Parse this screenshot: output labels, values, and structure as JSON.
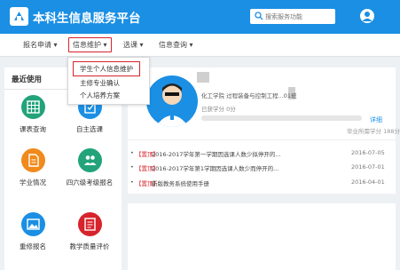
{
  "header": {
    "app_title": "本科生信息服务平台",
    "search_placeholder": "搜索服务功能"
  },
  "nav": {
    "items": [
      {
        "label": "报名申请 ▾"
      },
      {
        "label": "信息维护 ▾"
      },
      {
        "label": "选课 ▾"
      },
      {
        "label": "信息查询 ▾"
      }
    ]
  },
  "dropdown": {
    "items": [
      {
        "label": "学生个人信息维护"
      },
      {
        "label": "主修专业确认"
      },
      {
        "label": "个人培养方案"
      }
    ]
  },
  "sidebar": {
    "title": "最近使用",
    "tiles": [
      {
        "label": "课表查询",
        "color": "#22a37a",
        "icon": "calendar-grid-icon"
      },
      {
        "label": "自主选课",
        "color": "#1a8fe4",
        "icon": "book-select-icon"
      },
      {
        "label": "学业情况",
        "color": "#f08a1c",
        "icon": "document-icon"
      },
      {
        "label": "四六级考级报名",
        "color": "#22a37a",
        "icon": "people-icon"
      },
      {
        "label": "重修报名",
        "color": "#1a8fe4",
        "icon": "image-icon"
      },
      {
        "label": "教学质量评价",
        "color": "#d7232c",
        "icon": "survey-icon"
      }
    ]
  },
  "profile": {
    "info": "化工学院 过程装备与控制工程...01班",
    "credits_earned": "已获学分 0分",
    "detail_label": "详细",
    "required_credits": "毕业所需学分 188分",
    "progress": 0
  },
  "notices": [
    {
      "tag": "【置顶】",
      "title": "2016-2017学年第一学期因选课人数少拟停开的...",
      "date": "2016-07-05"
    },
    {
      "tag": "【置顶】",
      "title": "2016-2017学年第1学期因选课人数少而停开的...",
      "date": "2016-07-01"
    },
    {
      "tag": "【置顶】",
      "title": "新版教务系统使用手册",
      "date": "2016-04-01"
    }
  ],
  "colors": {
    "primary": "#1a8fe4",
    "highlight": "#d7232c"
  }
}
